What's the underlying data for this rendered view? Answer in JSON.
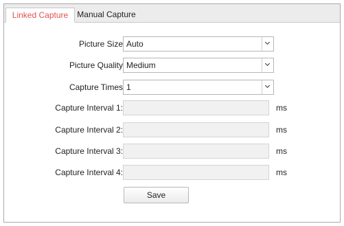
{
  "tabs": [
    {
      "label": "Linked Capture",
      "active": true
    },
    {
      "label": "Manual Capture",
      "active": false
    }
  ],
  "form": {
    "picture_size": {
      "label": "Picture Size",
      "value": "Auto"
    },
    "picture_quality": {
      "label": "Picture Quality",
      "value": "Medium"
    },
    "capture_times": {
      "label": "Capture Times",
      "value": "1"
    },
    "intervals": [
      {
        "label": "Capture Interval 1:",
        "value": "",
        "unit": "ms"
      },
      {
        "label": "Capture Interval 2:",
        "value": "",
        "unit": "ms"
      },
      {
        "label": "Capture Interval 3:",
        "value": "",
        "unit": "ms"
      },
      {
        "label": "Capture Interval 4:",
        "value": "",
        "unit": "ms"
      }
    ]
  },
  "save_label": "Save",
  "colors": {
    "active_tab_text": "#e05050",
    "tab_bar_bg": "#ececec",
    "disabled_input_bg": "#f1f1f1"
  }
}
